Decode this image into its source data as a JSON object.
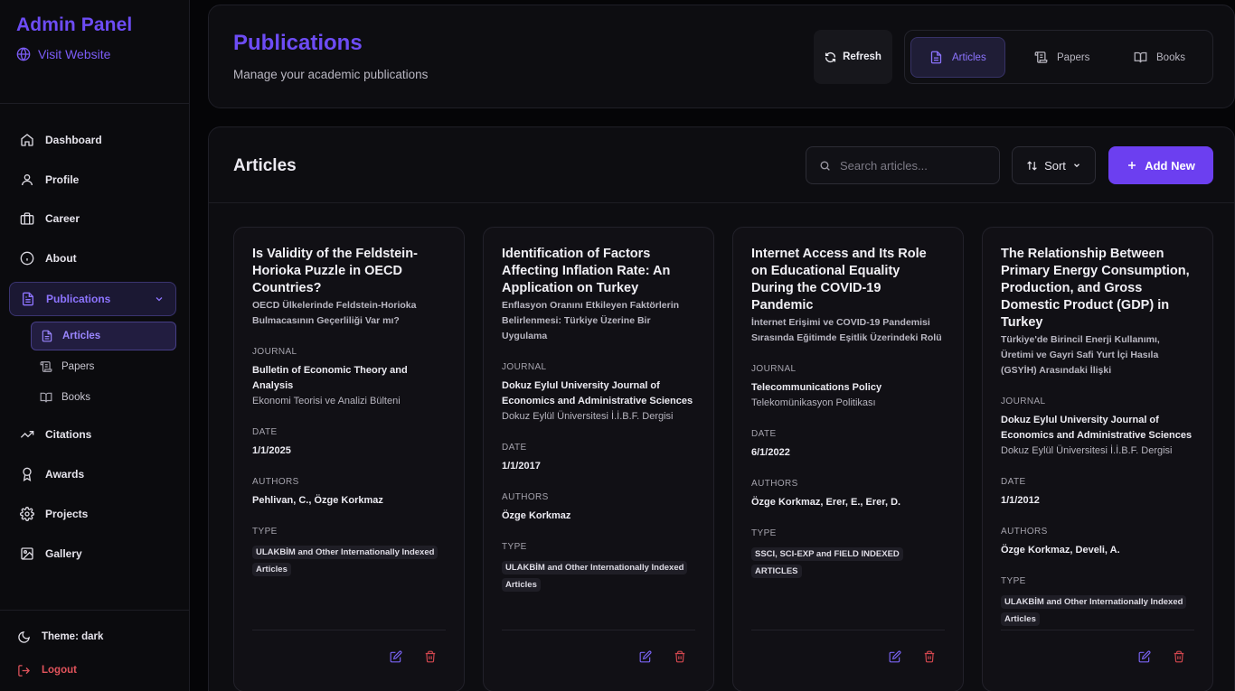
{
  "sidebar": {
    "brand": "Admin Panel",
    "visit_label": "Visit Website",
    "items": [
      {
        "label": "Dashboard",
        "icon": "home-icon"
      },
      {
        "label": "Profile",
        "icon": "user-icon"
      },
      {
        "label": "Career",
        "icon": "briefcase-icon"
      },
      {
        "label": "About",
        "icon": "info-icon"
      },
      {
        "label": "Publications",
        "icon": "document-icon"
      },
      {
        "label": "Citations",
        "icon": "trending-up-icon"
      },
      {
        "label": "Awards",
        "icon": "award-icon"
      },
      {
        "label": "Projects",
        "icon": "gear-icon"
      },
      {
        "label": "Gallery",
        "icon": "image-icon"
      }
    ],
    "sub_items": [
      {
        "label": "Articles",
        "icon": "document-icon"
      },
      {
        "label": "Papers",
        "icon": "scroll-icon"
      },
      {
        "label": "Books",
        "icon": "book-icon"
      }
    ],
    "theme_label": "Theme: dark",
    "logout_label": "Logout"
  },
  "header": {
    "title": "Publications",
    "subtitle": "Manage your academic publications",
    "refresh_label": "Refresh",
    "tabs": [
      {
        "label": "Articles",
        "icon": "document-icon"
      },
      {
        "label": "Papers",
        "icon": "scroll-icon"
      },
      {
        "label": "Books",
        "icon": "book-icon"
      }
    ]
  },
  "main": {
    "title": "Articles",
    "search_placeholder": "Search articles...",
    "sort_label": "Sort",
    "add_label": "Add New",
    "labels": {
      "journal": "JOURNAL",
      "date": "DATE",
      "authors": "AUTHORS",
      "type": "TYPE"
    },
    "articles": [
      {
        "title": "Is Validity of the Feldstein-Horioka Puzzle in OECD Countries?",
        "title_tr": "OECD Ülkelerinde Feldstein-Horioka Bulmacasının Geçerliliği Var mı?",
        "journal": "Bulletin of Economic Theory and Analysis",
        "journal_tr": "Ekonomi Teorisi ve Analizi Bülteni",
        "date": "1/1/2025",
        "authors": "Pehlivan, C., Özge Korkmaz",
        "type": "ULAKBİM and Other Internationally Indexed Articles"
      },
      {
        "title": "Identification of Factors Affecting Inflation Rate: An Application on Turkey",
        "title_tr": "Enflasyon Oranını Etkileyen Faktörlerin Belirlenmesi: Türkiye Üzerine Bir Uygulama",
        "journal": "Dokuz Eylul University Journal of Economics and Administrative Sciences",
        "journal_tr": "Dokuz Eylül Üniversitesi İ.İ.B.F. Dergisi",
        "date": "1/1/2017",
        "authors": "Özge Korkmaz",
        "type": "ULAKBİM and Other Internationally Indexed Articles"
      },
      {
        "title": "Internet Access and Its Role on Educational Equality During the COVID-19 Pandemic",
        "title_tr": "İnternet Erişimi ve COVID-19 Pandemisi Sırasında Eğitimde Eşitlik Üzerindeki Rolü",
        "journal": "Telecommunications Policy",
        "journal_tr": "Telekomünikasyon Politikası",
        "date": "6/1/2022",
        "authors": "Özge Korkmaz, Erer, E., Erer, D.",
        "type": "SSCI, SCI-EXP and FIELD INDEXED ARTICLES"
      },
      {
        "title": "The Relationship Between Primary Energy Consumption, Production, and Gross Domestic Product (GDP) in Turkey",
        "title_tr": "Türkiye'de Birincil Enerji Kullanımı, Üretimi ve Gayri Safi Yurt İçi Hasıla (GSYİH) Arasındaki İlişki",
        "journal": "Dokuz Eylul University Journal of Economics and Administrative Sciences",
        "journal_tr": "Dokuz Eylül Üniversitesi İ.İ.B.F. Dergisi",
        "date": "1/1/2012",
        "authors": "Özge Korkmaz, Develi, A.",
        "type": "ULAKBİM and Other Internationally Indexed Articles"
      }
    ]
  },
  "colors": {
    "accent": "#6d4cf5",
    "button": "#6c3ff0",
    "danger": "#d3474f",
    "background": "#050507"
  }
}
